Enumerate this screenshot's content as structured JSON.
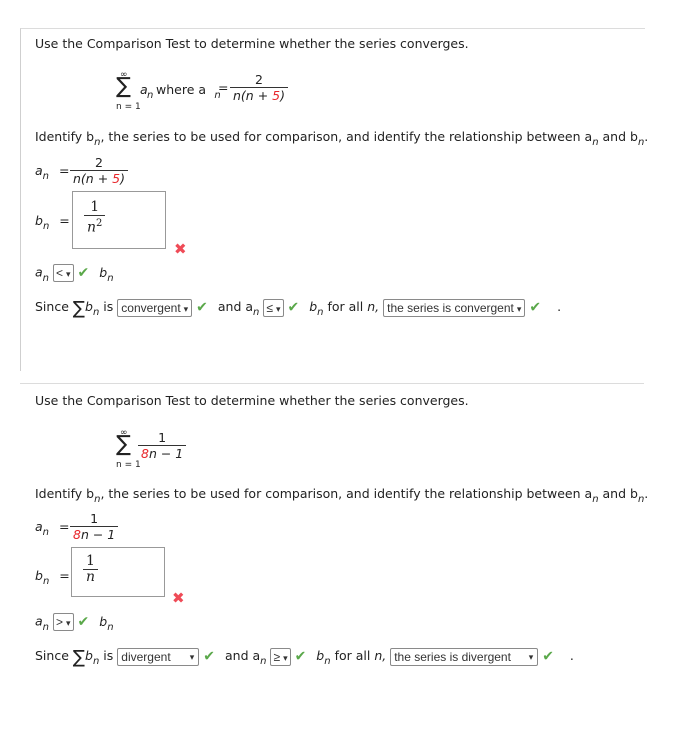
{
  "problems": [
    {
      "prompt": "Use the Comparison Test to determine whether the series converges.",
      "series": {
        "sum_upper": "∞",
        "sum_lower": "n = 1",
        "term": "a",
        "term_sub": "n",
        "where": "where a",
        "where_sub": "n",
        "eq": "=",
        "numerator": "2",
        "denominator_pre": "n(n + ",
        "denominator_red": "5",
        "denominator_post": ")"
      },
      "identify": {
        "pre": "Identify b",
        "sub1": "n",
        "mid": ", the series to be used for comparison, and identify the relationship between a",
        "sub2": "n",
        "and": " and b",
        "sub3": "n",
        "end": "."
      },
      "an": {
        "label": "a",
        "sub": "n",
        "eq": "=",
        "numerator": "2",
        "den_pre": "n(n + ",
        "den_red": "5",
        "den_post": ")"
      },
      "bn": {
        "label": "b",
        "sub": "n",
        "eq": "=",
        "answer_numerator": "1",
        "answer_denominator": "n",
        "answer_exponent": "2",
        "status": "incorrect"
      },
      "relation": {
        "a": "a",
        "a_sub": "n",
        "selected": "<",
        "status": "correct",
        "b": "b",
        "b_sub": "n"
      },
      "conclusion": {
        "since": "Since",
        "sigma": "∑",
        "b": "b",
        "b_sub": "n",
        "is": "is",
        "convergence_selected": "convergent",
        "and": "and a",
        "a_sub": "n",
        "ineq_selected": "≤",
        "b2": "b",
        "b2_sub": "n",
        "for_all": "for all",
        "n": "n,",
        "result_selected": "the series is convergent",
        "period": "."
      }
    },
    {
      "prompt": "Use the Comparison Test to determine whether the series converges.",
      "series": {
        "sum_upper": "∞",
        "sum_lower": "n = 1",
        "numerator": "1",
        "denominator_red": "8",
        "denominator_post": "n − 1"
      },
      "identify": {
        "pre": "Identify b",
        "sub1": "n",
        "mid": ", the series to be used for comparison, and identify the relationship between a",
        "sub2": "n",
        "and": " and b",
        "sub3": "n",
        "end": "."
      },
      "an": {
        "label": "a",
        "sub": "n",
        "eq": "=",
        "numerator": "1",
        "den_red": "8",
        "den_post": "n − 1"
      },
      "bn": {
        "label": "b",
        "sub": "n",
        "eq": "=",
        "answer_numerator": "1",
        "answer_denominator": "n",
        "status": "incorrect"
      },
      "relation": {
        "a": "a",
        "a_sub": "n",
        "selected": ">",
        "status": "correct",
        "b": "b",
        "b_sub": "n"
      },
      "conclusion": {
        "since": "Since",
        "sigma": "∑",
        "b": "b",
        "b_sub": "n",
        "is": "is",
        "convergence_selected": "divergent",
        "and": "and a",
        "a_sub": "n",
        "ineq_selected": "≥",
        "b2": "b",
        "b2_sub": "n",
        "for_all": "for all",
        "n": "n,",
        "result_selected": "the series is divergent",
        "period": "."
      }
    }
  ],
  "icons": {
    "correct": "✔",
    "incorrect": "✖",
    "chevron": "⌄"
  },
  "colors": {
    "correct": "#5aa84a",
    "incorrect": "#ef4b57",
    "highlight": "#e8262b"
  }
}
